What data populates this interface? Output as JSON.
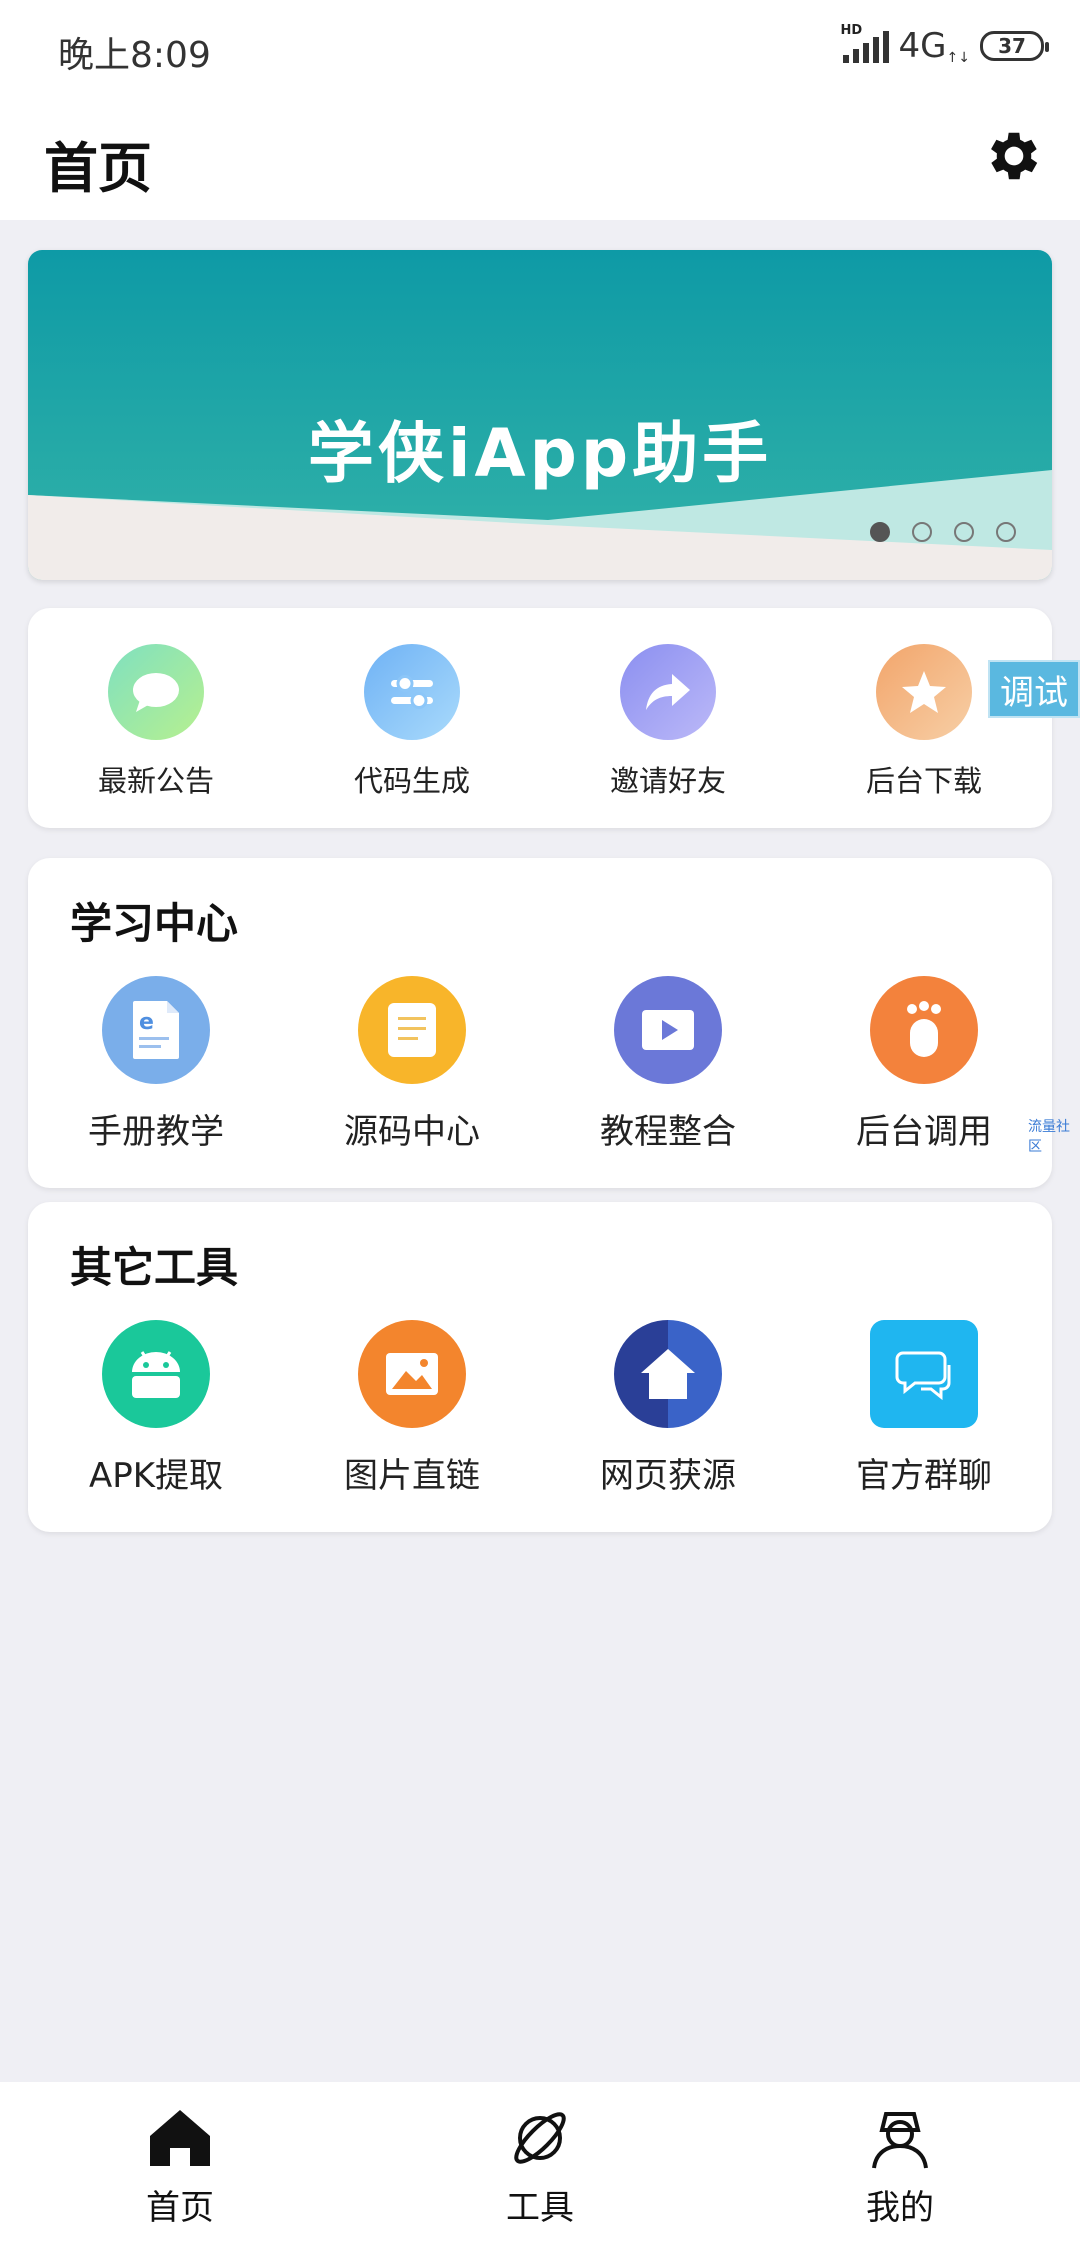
{
  "status": {
    "time": "晚上8:09",
    "network": "4G",
    "battery": "37"
  },
  "header": {
    "title": "首页"
  },
  "banner": {
    "title": "学侠iApp助手",
    "active_index": 1,
    "total": 4
  },
  "quick": [
    {
      "label": "最新公告",
      "icon": "chat-bubble-icon",
      "color": "#8fe0a8"
    },
    {
      "label": "代码生成",
      "icon": "sliders-icon",
      "color": "#7fbcf6"
    },
    {
      "label": "邀请好友",
      "icon": "share-arrow-icon",
      "color": "#9a9ef2"
    },
    {
      "label": "后台下载",
      "icon": "star-icon",
      "color": "#f3b07e"
    }
  ],
  "debug_label": "调试",
  "learn": {
    "title": "学习中心",
    "items": [
      {
        "label": "手册教学",
        "icon": "document-icon",
        "color": "#7aaeea"
      },
      {
        "label": "源码中心",
        "icon": "notes-icon",
        "color": "#f8b52a"
      },
      {
        "label": "教程整合",
        "icon": "video-play-icon",
        "color": "#6b78d8"
      },
      {
        "label": "后台调用",
        "icon": "footprint-icon",
        "color": "#f3823c"
      }
    ]
  },
  "watermark": "流量社区",
  "tools": {
    "title": "其它工具",
    "items": [
      {
        "label": "APK提取",
        "icon": "android-icon",
        "color": "#1ac89a"
      },
      {
        "label": "图片直链",
        "icon": "image-icon",
        "color": "#f3852d"
      },
      {
        "label": "网页获源",
        "icon": "house-icon",
        "color": "#2f4fa8"
      },
      {
        "label": "官方群聊",
        "icon": "chat-group-icon",
        "color": "#1fb6f0"
      }
    ]
  },
  "tabs": [
    {
      "label": "首页",
      "icon": "home-icon"
    },
    {
      "label": "工具",
      "icon": "planet-icon"
    },
    {
      "label": "我的",
      "icon": "user-icon"
    }
  ]
}
